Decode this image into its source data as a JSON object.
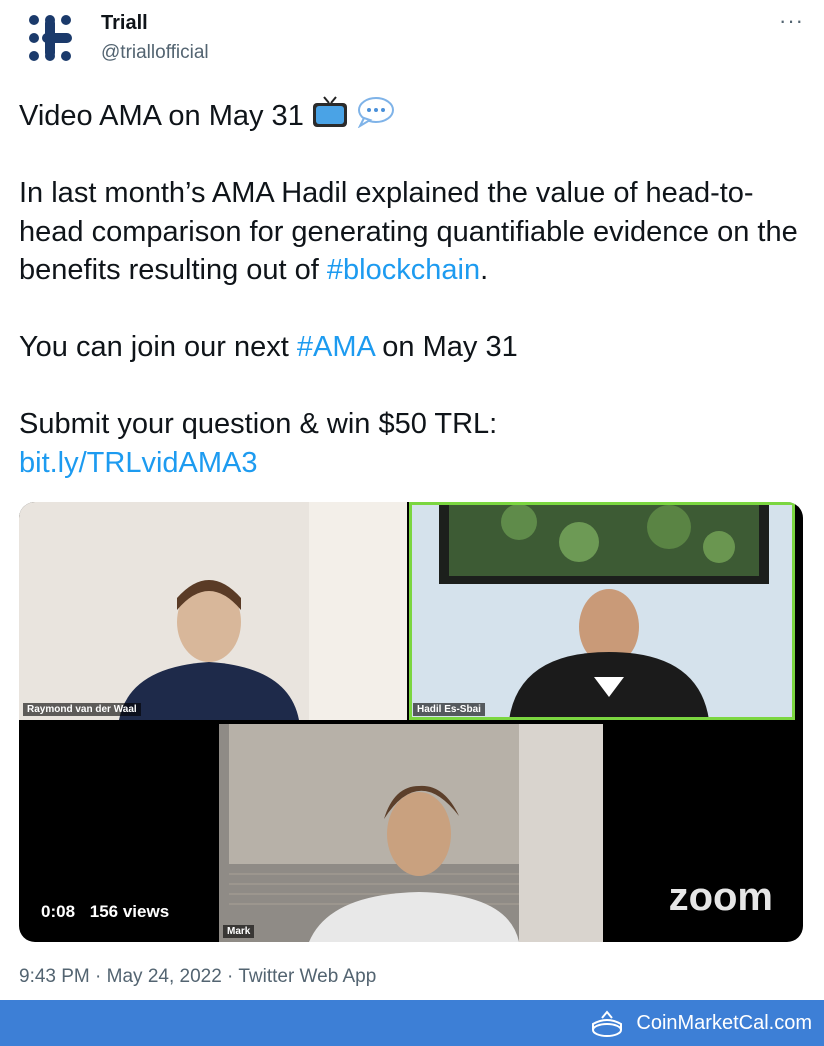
{
  "account": {
    "name": "Triall",
    "handle": "@triallofficial",
    "more_label": "···"
  },
  "tweet": {
    "line1": "Video AMA on May 31",
    "para2_a": "In last month’s AMA Hadil explained the value of head-to-head comparison for generating quantifiable evidence on the benefits resulting out of ",
    "hashtag_blockchain": "#blockchain",
    "para2_b": ".",
    "para3_a": "You can join our next ",
    "hashtag_ama": "#AMA",
    "para3_b": " on May 31",
    "para4": "Submit your question & win $50 TRL:",
    "link": "bit.ly/TRLvidAMA3"
  },
  "video": {
    "participants": [
      "Raymond van der Waal",
      "Hadil Es-Sbai",
      "Mark"
    ],
    "time": "0:08",
    "views": "156 views",
    "brand": "zoom"
  },
  "timestamp": {
    "text": "9:43 PM · May 24, 2022 · Twitter Web App"
  },
  "footer": {
    "brand": "CoinMarketCal.com"
  },
  "colors": {
    "link": "#1d9bf0",
    "footer": "#3d7fd6",
    "logo": "#1b3a6b"
  },
  "icons": [
    "triall-logo",
    "more-icon",
    "tv-emoji-icon",
    "speech-balloon-icon",
    "coinmarketcal-icon"
  ]
}
